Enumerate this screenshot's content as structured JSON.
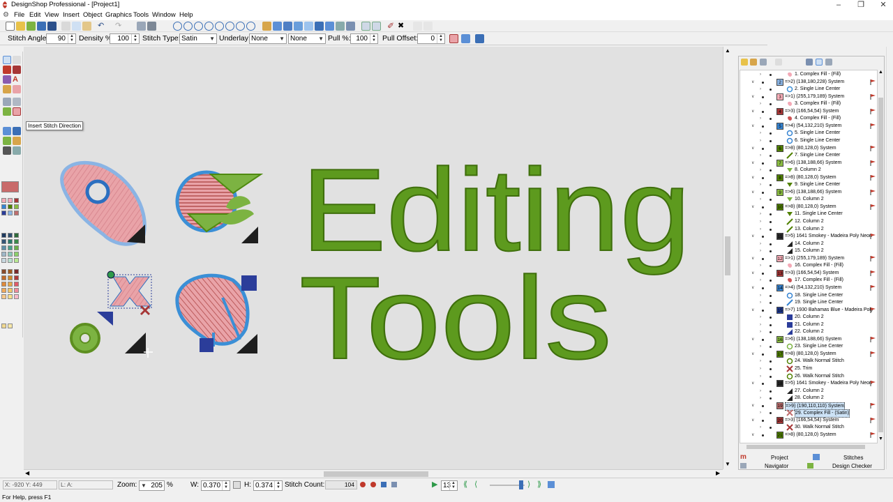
{
  "window": {
    "title": "DesignShop Professional - [Project1]"
  },
  "menu": [
    "File",
    "Edit",
    "View",
    "Insert",
    "Object",
    "Graphics",
    "Tools",
    "Window",
    "Help"
  ],
  "props": {
    "stitch_angle_label": "Stitch Angle:",
    "stitch_angle": "90",
    "density_label": "Density %",
    "density": "100",
    "stitch_type_label": "Stitch Type:",
    "stitch_type": "Satin",
    "underlay_label": "Underlay:",
    "underlay1": "None",
    "underlay2": "None",
    "pull_label": "Pull %:",
    "pull": "100",
    "pull_offset_label": "Pull Offset:",
    "pull_offset": "0"
  },
  "tooltip": "Insert Stitch Direction",
  "canvas": {
    "word1": "Editing",
    "word2": "Tools"
  },
  "sequence": [
    {
      "t": "o",
      "label": "1. Complex Fill - (Fill)",
      "icon": "blob",
      "color": "#f3a9b6"
    },
    {
      "t": "c",
      "num": "2",
      "label": "=>2) (138,180,228) System",
      "color": "#8ab4e4"
    },
    {
      "t": "o",
      "label": "2. Single Line Center",
      "icon": "ring",
      "color": "#3b8fd6"
    },
    {
      "t": "c",
      "num": "3",
      "label": "=>1) (255,179,189) System",
      "color": "#ffb3bd"
    },
    {
      "t": "o",
      "label": "3. Complex Fill - (Fill)",
      "icon": "blob",
      "color": "#f3a9b6"
    },
    {
      "t": "c",
      "num": "4",
      "label": "=>3) (166,54,54) System",
      "color": "#a63636"
    },
    {
      "t": "o",
      "label": "4. Complex Fill - (Fill)",
      "icon": "blob",
      "color": "#c55"
    },
    {
      "t": "c",
      "num": "5",
      "label": "=>4) (54,132,210) System",
      "color": "#3684d2"
    },
    {
      "t": "o",
      "label": "5. Single Line Center",
      "icon": "ring",
      "color": "#3684d2"
    },
    {
      "t": "o",
      "label": "6. Single Line Center",
      "icon": "ring",
      "color": "#3684d2"
    },
    {
      "t": "c",
      "num": "6",
      "label": "=>8) (80,128,0) System",
      "color": "#508000"
    },
    {
      "t": "o",
      "label": "7. Single Line Center",
      "icon": "slash",
      "color": "#508000"
    },
    {
      "t": "c",
      "num": "7",
      "label": "=>6) (138,188,66) System",
      "color": "#8abc42"
    },
    {
      "t": "o",
      "label": "8. Column 2",
      "icon": "tri",
      "color": "#7cb342"
    },
    {
      "t": "c",
      "num": "8",
      "label": "=>8) (80,128,0) System",
      "color": "#508000"
    },
    {
      "t": "o",
      "label": "9. Single Line Center",
      "icon": "tri",
      "color": "#508000"
    },
    {
      "t": "c",
      "num": "9",
      "label": "=>6) (138,188,66) System",
      "color": "#8abc42"
    },
    {
      "t": "o",
      "label": "10. Column 2",
      "icon": "tri",
      "color": "#7cb342"
    },
    {
      "t": "c",
      "num": "10",
      "label": "=>8) (80,128,0) System",
      "color": "#508000"
    },
    {
      "t": "o",
      "label": "11. Single Line Center",
      "icon": "tri",
      "color": "#508000"
    },
    {
      "t": "o",
      "label": "12. Column 2",
      "icon": "slash",
      "color": "#508000"
    },
    {
      "t": "o",
      "label": "13. Column 2",
      "icon": "slash",
      "color": "#508000"
    },
    {
      "t": "c",
      "num": "11",
      "label": "=>5) 1641 Smokey - Madeira Poly Neon",
      "color": "#2a2a2a"
    },
    {
      "t": "o",
      "label": "14. Column 2",
      "icon": "wedge",
      "color": "#222"
    },
    {
      "t": "o",
      "label": "15. Column 2",
      "icon": "wedge",
      "color": "#222"
    },
    {
      "t": "c",
      "num": "12",
      "label": "=>1) (255,179,189) System",
      "color": "#ffb3bd"
    },
    {
      "t": "o",
      "label": "16. Complex Fill - (Fill)",
      "icon": "blob",
      "color": "#f3a9b6"
    },
    {
      "t": "c",
      "num": "13",
      "label": "=>3) (166,54,54) System",
      "color": "#a63636"
    },
    {
      "t": "o",
      "label": "17. Complex Fill - (Fill)",
      "icon": "blob",
      "color": "#c55"
    },
    {
      "t": "c",
      "num": "14",
      "label": "=>4) (54,132,210) System",
      "color": "#3684d2"
    },
    {
      "t": "o",
      "label": "18. Single Line Center",
      "icon": "ring",
      "color": "#3684d2"
    },
    {
      "t": "o",
      "label": "19. Single Line Center",
      "icon": "slash",
      "color": "#3684d2"
    },
    {
      "t": "c",
      "num": "15",
      "label": "=>7) 1930 Bahamas Blue - Madeira Poly",
      "color": "#1f3a93"
    },
    {
      "t": "o",
      "label": "20. Column 2",
      "icon": "sq",
      "color": "#2b3d9a"
    },
    {
      "t": "o",
      "label": "21. Column 2",
      "icon": "sq",
      "color": "#2b3d9a"
    },
    {
      "t": "o",
      "label": "22. Column 2",
      "icon": "wedge",
      "color": "#2b3d9a"
    },
    {
      "t": "c",
      "num": "16",
      "label": "=>6) (138,188,66) System",
      "color": "#8abc42"
    },
    {
      "t": "o",
      "label": "23. Single Line Center",
      "icon": "ring",
      "color": "#7cb342"
    },
    {
      "t": "c",
      "num": "17",
      "label": "=>8) (80,128,0) System",
      "color": "#508000"
    },
    {
      "t": "o",
      "label": "24. Walk Normal Stitch",
      "icon": "ring",
      "color": "#508000"
    },
    {
      "t": "o",
      "label": "25. Trim",
      "icon": "x",
      "color": "#a63636"
    },
    {
      "t": "o",
      "label": "26. Walk Normal Stitch",
      "icon": "ring",
      "color": "#508000"
    },
    {
      "t": "c",
      "num": "18",
      "label": "=>5) 1641 Smokey - Madeira Poly Neon",
      "color": "#2a2a2a"
    },
    {
      "t": "o",
      "label": "27. Column 2",
      "icon": "wedge",
      "color": "#222"
    },
    {
      "t": "o",
      "label": "28. Column 2",
      "icon": "wedge",
      "color": "#222"
    },
    {
      "t": "c",
      "num": "19",
      "label": "=>9) (190,110,110) System",
      "color": "#be6e6e",
      "sel": true
    },
    {
      "t": "o",
      "label": "29. Complex Fill - (Satin)",
      "icon": "x",
      "color": "#be6e6e",
      "sel": true
    },
    {
      "t": "c",
      "num": "20",
      "label": "=>3) (166,54,54) System",
      "color": "#a63636"
    },
    {
      "t": "o",
      "label": "30. Walk Normal Stitch",
      "icon": "x",
      "color": "#a63636"
    },
    {
      "t": "c",
      "num": "21",
      "label": "=>8) (80,128,0) System",
      "color": "#508000"
    }
  ],
  "tabs": {
    "project": "Project",
    "stitches": "Stitches",
    "navigator": "Navigator",
    "checker": "Design Checker"
  },
  "status": {
    "coords": "X: -920  Y: 449",
    "la": "L: A:",
    "zoom_label": "Zoom:",
    "zoom": "205",
    "zoom_unit": "%",
    "w_label": "W:",
    "w": "0.370",
    "h_label": "H:",
    "h": "0.374",
    "stitch_count_label": "Stitch Count:",
    "stitch_count": "104",
    "frame": "13"
  },
  "help": "For Help, press F1",
  "colors": {
    "green_dark": "#4f8a10",
    "green_light": "#7cb342",
    "pink": "#e9a3a8",
    "blue": "#3b8fd6",
    "navy": "#2b3d9a",
    "black": "#1e1e1e",
    "crimson": "#a63636"
  }
}
